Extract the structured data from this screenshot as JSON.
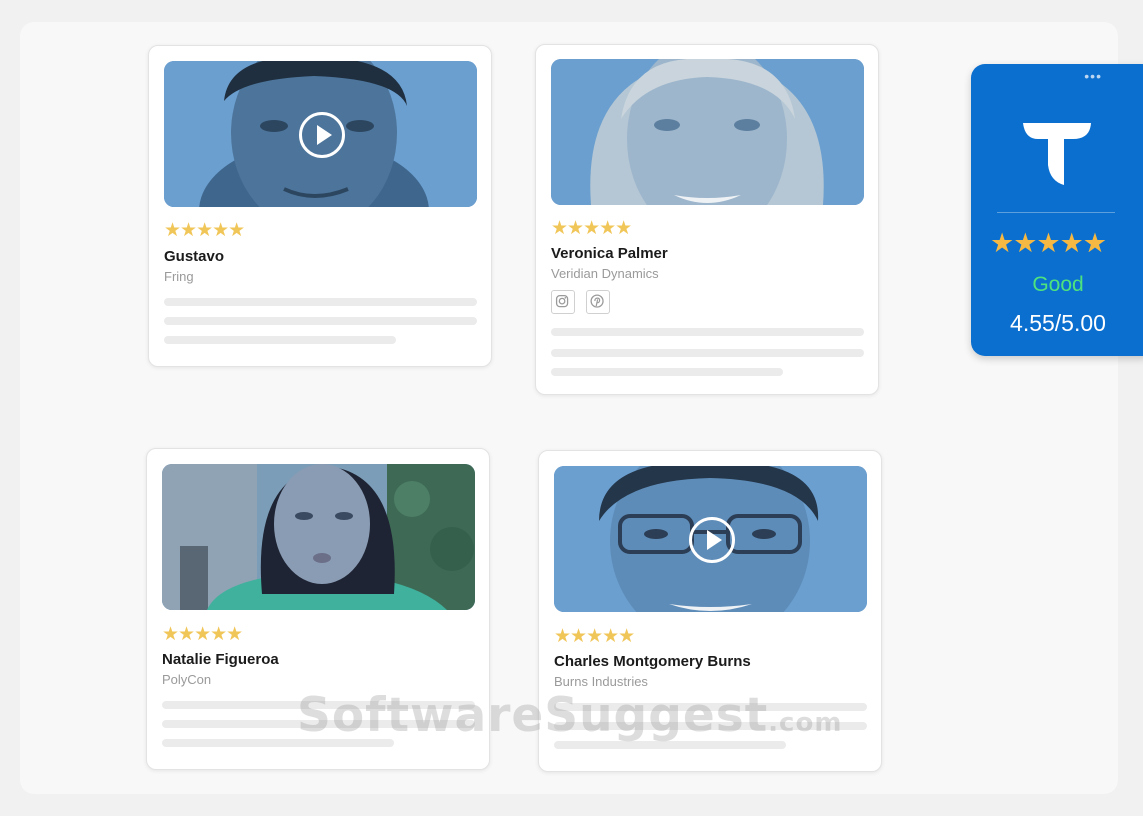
{
  "testimonials": [
    {
      "rating_stars": "★★★★★",
      "rating": 5,
      "name": "Gustavo",
      "company": "Fring",
      "has_video": true
    },
    {
      "rating_stars": "★★★★★",
      "rating": 5,
      "name": "Veronica Palmer",
      "company": "Veridian Dynamics",
      "has_video": false,
      "social": [
        "instagram-icon",
        "pinterest-icon"
      ]
    },
    {
      "rating_stars": "★★★★★",
      "rating": 5,
      "name": "Natalie Figueroa",
      "company": "PolyCon",
      "has_video": false
    },
    {
      "rating_stars": "★★★★★",
      "rating": 5,
      "name": "Charles Montgomery Burns",
      "company": "Burns Industries",
      "has_video": true
    }
  ],
  "rating_badge": {
    "logo": "T",
    "menu_dots": "•••",
    "stars_full": "★★★★",
    "star_partial": "★",
    "stars_value": 4.55,
    "label": "Good",
    "score": "4.55/5.00"
  },
  "watermark": {
    "main": "SoftwareSuggest",
    "suffix": ".com"
  },
  "colors": {
    "badge_bg": "#0b6fcf",
    "star": "#f1c659",
    "good": "#4ee27e",
    "media_tint": "#5b8fc1"
  }
}
